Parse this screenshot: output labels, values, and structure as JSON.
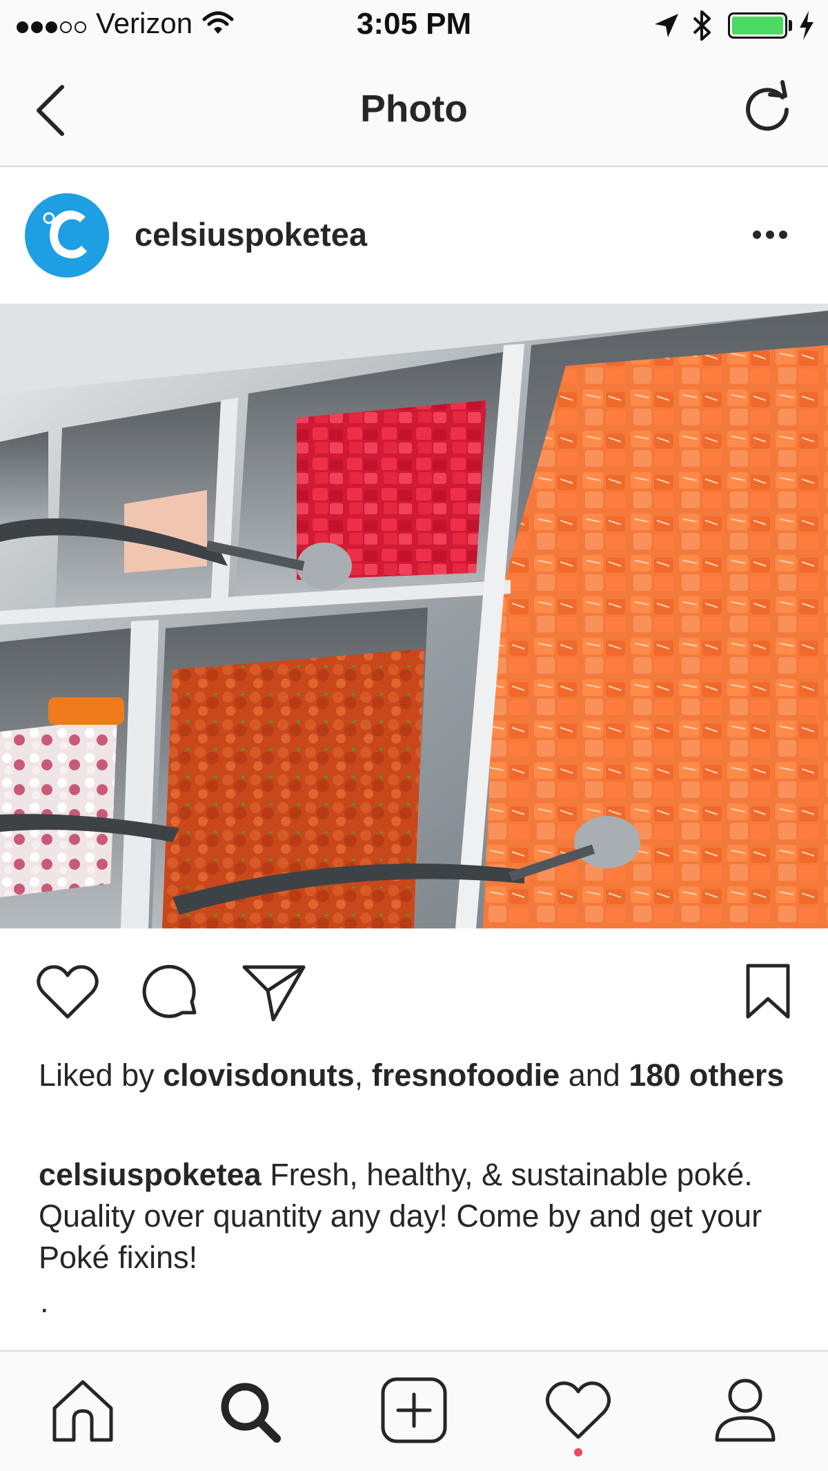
{
  "status_bar": {
    "carrier": "Verizon",
    "signal_bars_filled": 3,
    "signal_bars_total": 5,
    "time": "3:05 PM",
    "battery_color": "#4cd964"
  },
  "nav": {
    "title": "Photo",
    "back_icon": "chevron-left-icon",
    "refresh_icon": "refresh-icon"
  },
  "post": {
    "username": "celsiuspoketea",
    "avatar_color": "#1e9ee3",
    "likes": {
      "prefix": "Liked by",
      "user1": "clovisdonuts",
      "separator": ",",
      "user2": "fresnofoodie",
      "conjunction": "and",
      "others": "180 others"
    },
    "caption": {
      "user": "celsiuspoketea",
      "text": "Fresh, healthy, & sustainable poké. Quality over quantity any day! Come by and get your Poké fixins!",
      "trailing": "."
    }
  },
  "tab_bar": {
    "tabs": [
      "home-icon",
      "search-icon",
      "add-icon",
      "heart-icon",
      "profile-icon"
    ],
    "active": "search-icon",
    "notification_dot_color": "#ed4956"
  }
}
